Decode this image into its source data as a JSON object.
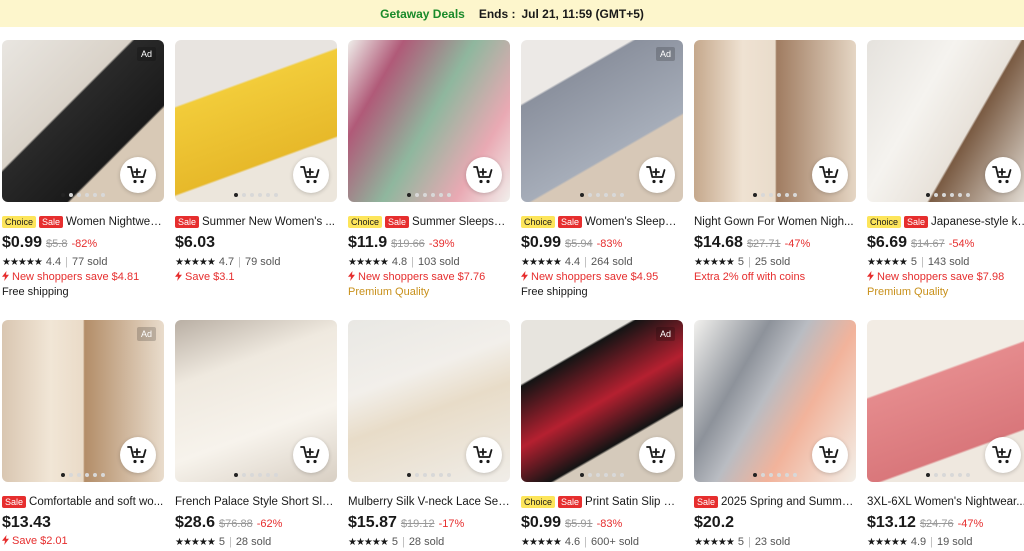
{
  "banner": {
    "deals": "Getaway Deals",
    "ends_label": "Ends :",
    "ends_value": "Jul 21, 11:59 (GMT+5)"
  },
  "products": [
    {
      "ad": "Ad",
      "choice": "Choice",
      "sale": "Sale",
      "title": "Women Nightwear...",
      "price": "$0.99",
      "orig": "$5.8",
      "disc": "-82%",
      "rating": "4.4",
      "sold": "77 sold",
      "promo": "New shoppers save $4.81",
      "promo2": "Free shipping"
    },
    {
      "ad": "",
      "choice": "",
      "sale": "Sale",
      "title": "Summer New Women's ...",
      "price": "$6.03",
      "orig": "",
      "disc": "",
      "rating": "4.7",
      "sold": "79 sold",
      "promo": "Save $3.1",
      "promo2": ""
    },
    {
      "ad": "",
      "choice": "Choice",
      "sale": "Sale",
      "title": "Summer Sleepshir...",
      "price": "$11.9",
      "orig": "$19.66",
      "disc": "-39%",
      "rating": "4.8",
      "sold": "103 sold",
      "promo": "New shoppers save $7.76",
      "promo2": "Premium Quality"
    },
    {
      "ad": "Ad",
      "choice": "Choice",
      "sale": "Sale",
      "title": "Women's Sleepwe...",
      "price": "$0.99",
      "orig": "$5.94",
      "disc": "-83%",
      "rating": "4.4",
      "sold": "264 sold",
      "promo": "New shoppers save $4.95",
      "promo2": "Free shipping"
    },
    {
      "ad": "",
      "choice": "",
      "sale": "",
      "title": "Night Gown For Women Nigh...",
      "price": "$14.68",
      "orig": "$27.71",
      "disc": "-47%",
      "rating": "5",
      "sold": "25 sold",
      "promo": "Extra 2% off with coins",
      "promo2": ""
    },
    {
      "ad": "",
      "choice": "Choice",
      "sale": "Sale",
      "title": "Japanese-style ki...",
      "price": "$6.69",
      "orig": "$14.67",
      "disc": "-54%",
      "rating": "5",
      "sold": "143 sold",
      "promo": "New shoppers save $7.98",
      "promo2": "Premium Quality"
    },
    {
      "ad": "Ad",
      "choice": "",
      "sale": "Sale",
      "title": "Comfortable and soft wo...",
      "price": "$13.43",
      "orig": "",
      "disc": "",
      "rating": "",
      "sold": "",
      "promo": "Save $2.01",
      "promo2": ""
    },
    {
      "ad": "",
      "choice": "",
      "sale": "",
      "title": "French Palace Style Short Sle...",
      "price": "$28.6",
      "orig": "$76.88",
      "disc": "-62%",
      "rating": "5",
      "sold": "28 sold",
      "promo": "",
      "promo2": ""
    },
    {
      "ad": "",
      "choice": "",
      "sale": "",
      "title": "Mulberry Silk V-neck Lace Sex...",
      "price": "$15.87",
      "orig": "$19.12",
      "disc": "-17%",
      "rating": "5",
      "sold": "28 sold",
      "promo": "",
      "promo2": ""
    },
    {
      "ad": "Ad",
      "choice": "Choice",
      "sale": "Sale",
      "title": "Print Satin Slip Nig...",
      "price": "$0.99",
      "orig": "$5.91",
      "disc": "-83%",
      "rating": "4.6",
      "sold": "600+ sold",
      "promo": "",
      "promo2": ""
    },
    {
      "ad": "",
      "choice": "",
      "sale": "Sale",
      "title": "2025 Spring and Summe...",
      "price": "$20.2",
      "orig": "",
      "disc": "",
      "rating": "5",
      "sold": "23 sold",
      "promo": "",
      "promo2": ""
    },
    {
      "ad": "",
      "choice": "",
      "sale": "",
      "title": "3XL-6XL Women's Nightwear...",
      "price": "$13.12",
      "orig": "$24.76",
      "disc": "-47%",
      "rating": "4.9",
      "sold": "19 sold",
      "promo": "",
      "promo2": ""
    }
  ],
  "colors": {
    "banner_bg": "#fdf6cc",
    "deals_green": "#1a8a2a",
    "sale_red": "#e62e2e",
    "choice_yellow": "#fde55a",
    "gold_text": "#c8901a"
  },
  "icons": {
    "cart": "add-to-cart-icon",
    "bolt": "lightning-icon",
    "star": "star-icon"
  }
}
